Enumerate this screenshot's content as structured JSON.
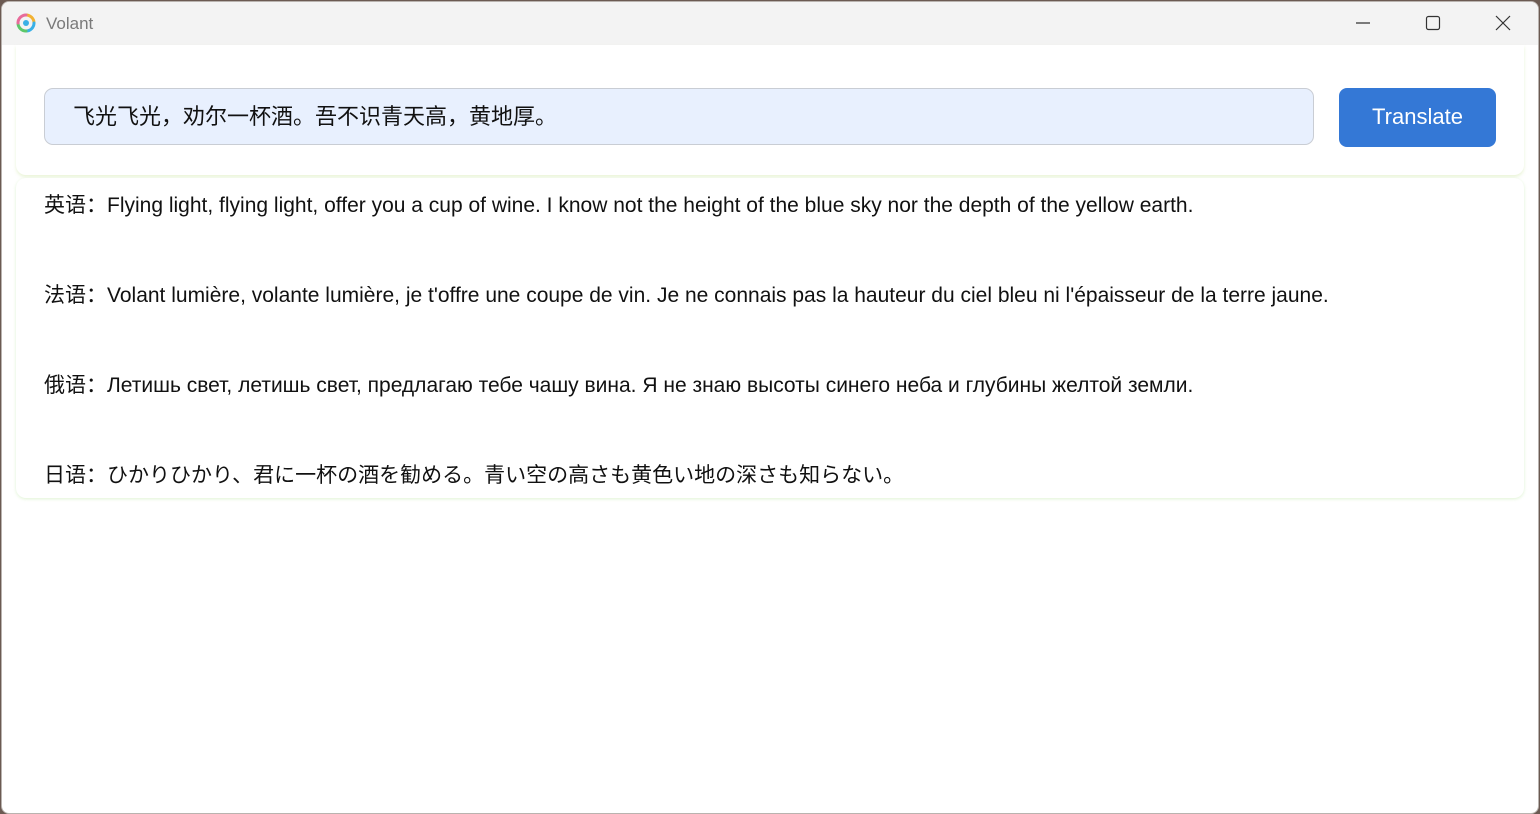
{
  "window": {
    "title": "Volant"
  },
  "input": {
    "value": "飞光飞光，劝尔一杯酒。吾不识青天高，黄地厚。"
  },
  "translate_button": {
    "label": "Translate"
  },
  "results": [
    {
      "label": "英语：",
      "text": "Flying light, flying light, offer you a cup of wine. I know not the height of the blue sky nor the depth of the yellow earth."
    },
    {
      "label": "法语：",
      "text": "Volant lumière, volante lumière, je t'offre une coupe de vin. Je ne connais pas la hauteur du ciel bleu ni l'épaisseur de la terre jaune."
    },
    {
      "label": "俄语：",
      "text": "Летишь свет, летишь свет, предлагаю тебе чашу вина. Я не знаю высоты синего неба и глубины желтой земли."
    },
    {
      "label": "日语：",
      "text": "ひかりひかり、君に一杯の酒を勧める。青い空の高さも黄色い地の深さも知らない。"
    }
  ],
  "icons": {
    "app": "volant-logo-icon",
    "minimize": "minimize-icon",
    "maximize": "maximize-icon",
    "close": "close-icon"
  },
  "colors": {
    "accent": "#3478d6",
    "input_background": "#e8f0fe",
    "titlebar": "#f3f3f3"
  }
}
